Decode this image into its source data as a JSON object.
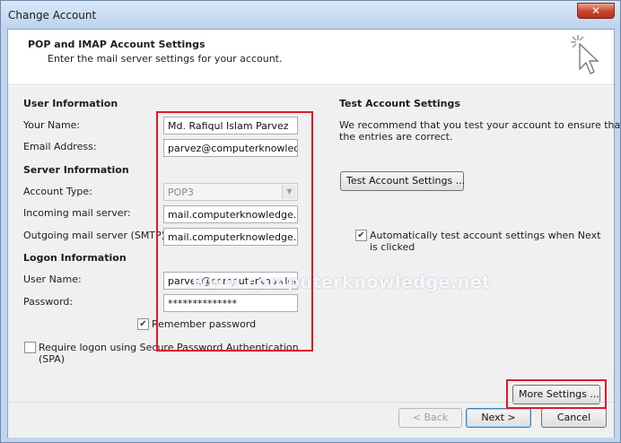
{
  "window": {
    "title": "Change Account",
    "close_glyph": "✕"
  },
  "header": {
    "title": "POP and IMAP Account Settings",
    "subtitle": "Enter the mail server settings for your account.",
    "icon": "wizard-cursor-icon"
  },
  "user_info": {
    "heading": "User Information",
    "your_name_label": "Your Name:",
    "your_name_value": "Md. Rafiqul Islam Parvez",
    "email_label": "Email Address:",
    "email_value": "parvez@computerknowledge"
  },
  "server_info": {
    "heading": "Server Information",
    "account_type_label": "Account Type:",
    "account_type_value": "POP3",
    "incoming_label": "Incoming mail server:",
    "incoming_value": "mail.computerknowledge.ne",
    "outgoing_label": "Outgoing mail server (SMTP):",
    "outgoing_value": "mail.computerknowledge.ne"
  },
  "logon_info": {
    "heading": "Logon Information",
    "username_label": "User Name:",
    "username_value": "parvez@computerknowledge",
    "password_label": "Password:",
    "password_value": "**************",
    "remember_label": "Remember password",
    "remember_checked": true,
    "spa_label_line1": "Require logon using Secure Password Authentication",
    "spa_label_line2": "(SPA)",
    "spa_checked": false
  },
  "test_settings": {
    "heading": "Test Account Settings",
    "description_line1": "We recommend that you test your account to ensure that",
    "description_line2": "the entries are correct.",
    "test_button_label": "Test Account Settings ...",
    "auto_test_line1": "Automatically test account settings when Next",
    "auto_test_line2": "is clicked",
    "auto_test_checked": true
  },
  "more_settings_label": "More Settings ...",
  "check_glyph": "✔",
  "dropdown_glyph": "▼",
  "watermark": "www.computerknowledge.net",
  "footer": {
    "back_label": "< Back",
    "next_label": "Next >",
    "cancel_label": "Cancel"
  },
  "colors": {
    "highlight": "#e0182c",
    "window_frame": "#bfd6ee"
  }
}
